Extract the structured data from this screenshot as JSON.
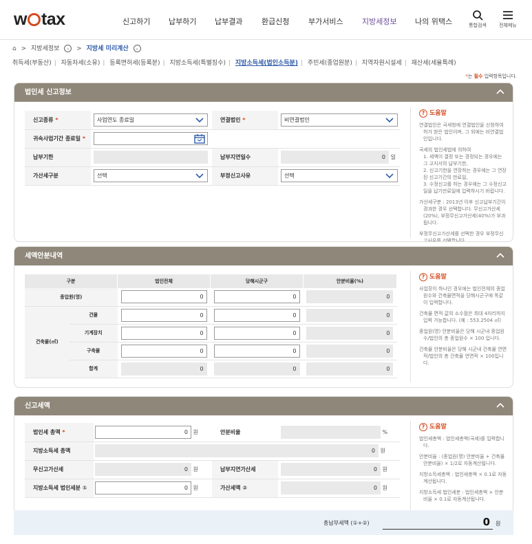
{
  "header": {
    "logo": {
      "pre": "w",
      "post": "tax"
    },
    "nav": [
      "신고하기",
      "납부하기",
      "납부결과",
      "환급신청",
      "부가서비스",
      "지방세정보",
      "나의 위택스"
    ],
    "active_nav": "지방세정보",
    "search_label": "통합검색",
    "menu_label": "전체메뉴"
  },
  "breadcrumb": {
    "items": [
      "지방세정보",
      "지방세 미리계산"
    ]
  },
  "tabs": [
    "취득세(부동산)",
    "자동차세(소유)",
    "등록면허세(등록분)",
    "지방소득세(특별징수)",
    "지방소득세(법인소득분)",
    "주민세(종업원분)",
    "지역자원시설세",
    "재산세(세율특례)"
  ],
  "active_tab": "지방소득세(법인소득분)",
  "required_note": {
    "star": "*",
    "prefix": "는 ",
    "bold": "필수",
    "suffix": " 입력항목입니다."
  },
  "section1": {
    "title": "법인세 신고정보",
    "report_type_label": "신고종류",
    "report_type_value": "사업연도 종료일",
    "consolidated_label": "연결법인",
    "consolidated_value": "비연결법인",
    "fiscal_end_label": "귀속사업기간 종료일",
    "fiscal_end_value": "",
    "due_date_label": "납부기한",
    "due_date_value": "",
    "delay_days_label": "납부지연일수",
    "delay_days_value": "0",
    "delay_days_unit": "일",
    "penalty_type_label": "가산세구분",
    "penalty_type_value": "선택",
    "improper_reason_label": "부정신고사유",
    "improper_reason_value": "선택",
    "help_title": "도움말",
    "help_items": [
      "연결법인은 국세청에 연결법인을 신청하여 허가 받은 법인이며, 그 외에는 비연결법인입니다.",
      "국세의 법인세법에 의하여\n1. 세액이 결정 또는 경정되는 경우에는 그 고지서의 납부기한,\n2. 신고기한을 연장하는 경우에는 그 연장된 신고기간의 만료일,\n3. 수정신고를 하는 경우에는 그 수정신고일을 납기만료일에 입력하시기 바랍니다.",
      "가산세구분 : 2013년 이후 신고납부기간이 경과한 경우 선택합니다. 무신고가산세(20%), 부정무신고가산세(40%)가 부과됩니다.",
      "부정무신고가산세를 선택한 경우 부정무신고사유를 선택합니다."
    ]
  },
  "section2": {
    "title": "세액안분내역",
    "headers": [
      "구분",
      "법인전체",
      "당해시군구",
      "안분비율(%)"
    ],
    "employees_label": "종업원(명)",
    "building_label": "건축물(㎡)",
    "sub_rows": [
      "건물",
      "기계장치",
      "구축물",
      "합계"
    ],
    "zero": "0",
    "help_title": "도움말",
    "help_items": [
      "사업장이 하나인 경우에는 법인전체의 종업원수와 건축물면적을 당해시군구에 똑같이 입력합니다.",
      "건축물 면적 값의 소수점은 최대 4자리까지 입력 가능합니다. (예 : 553.2504 ㎡)",
      "종업원(명) 안분비율은 당해 시군내 종업원수/법인의 총 종업원수 × 100 입니다.",
      "건축물 안분비율은 당해 시군내 건축물 연면적/법인의 총 건축물 연면적 × 100입니다."
    ]
  },
  "section3": {
    "title": "신고세액",
    "corp_tax_label": "법인세 총액",
    "corp_tax_value": "0",
    "ratio_label": "안분비율",
    "ratio_value": "",
    "ratio_unit": "%",
    "local_income_label": "지방소득세 총액",
    "local_income_value": "0",
    "no_report_label": "무신고가산세",
    "no_report_value": "0",
    "late_pay_label": "납부지연가산세",
    "late_pay_value": "0",
    "corp_portion_label": "지방소득세 법인세분 ①",
    "corp_portion_value": "0",
    "penalty_label": "가산세액 ②",
    "penalty_value": "0",
    "won": "원",
    "help_title": "도움말",
    "help_items": [
      "법인세총액 : 법인세총액(국세)를 입력합니다.",
      "안분비율 : (종업원(명) 안분비율 + 건축물 안분비율) × 1/2로 자동계산됩니다.",
      "지방소득세총액 : 법인세총액 × 0.1로 자동계산됩니다.",
      "지방소득세 법인세분 : 법인세총액 × 안분비율 × 0.1로 자동계산됩니다."
    ]
  },
  "total": {
    "label": "총납부세액 (①+②)",
    "value": "0",
    "unit": "원"
  }
}
